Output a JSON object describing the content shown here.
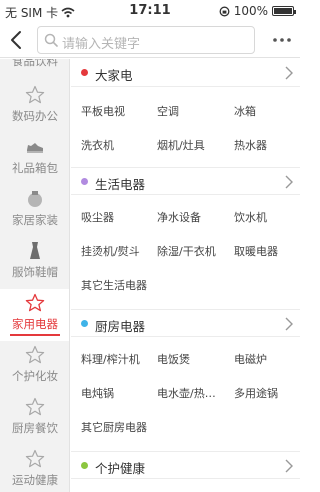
{
  "status_bar": {
    "carrier": "无 SIM 卡",
    "time": "17:11",
    "battery": "100%"
  },
  "header": {
    "search_placeholder": "请输入关键字"
  },
  "sidebar": {
    "items": [
      {
        "label": "食品饮料",
        "icon": "food-icon"
      },
      {
        "label": "数码办公",
        "icon": "star-icon"
      },
      {
        "label": "礼品箱包",
        "icon": "shoe-icon"
      },
      {
        "label": "家居家装",
        "icon": "home-decor-icon"
      },
      {
        "label": "服饰鞋帽",
        "icon": "dress-icon"
      },
      {
        "label": "家用电器",
        "icon": "star-icon",
        "active": true
      },
      {
        "label": "个护化妆",
        "icon": "star-icon"
      },
      {
        "label": "厨房餐饮",
        "icon": "star-icon"
      },
      {
        "label": "运动健康",
        "icon": "star-icon"
      }
    ]
  },
  "sections": [
    {
      "title": "大家电",
      "dot_color": "#e4393c",
      "items": [
        "平板电视",
        "空调",
        "冰箱",
        "洗衣机",
        "烟机/灶具",
        "热水器"
      ]
    },
    {
      "title": "生活电器",
      "dot_color": "#b18be0",
      "items": [
        "吸尘器",
        "净水设备",
        "饮水机",
        "挂烫机/熨斗",
        "除湿/干衣机",
        "取暖电器",
        "其它生活电器"
      ]
    },
    {
      "title": "厨房电器",
      "dot_color": "#3fb3e8",
      "items": [
        "料理/榨汁机",
        "电饭煲",
        "电磁炉",
        "电炖锅",
        "电水壶/热…",
        "多用途锅",
        "其它厨房电器"
      ]
    },
    {
      "title": "个护健康",
      "dot_color": "#8cc63f",
      "items": []
    }
  ],
  "colors": {
    "accent": "#e4393c",
    "sidebar_bg": "#f2f2f2"
  }
}
